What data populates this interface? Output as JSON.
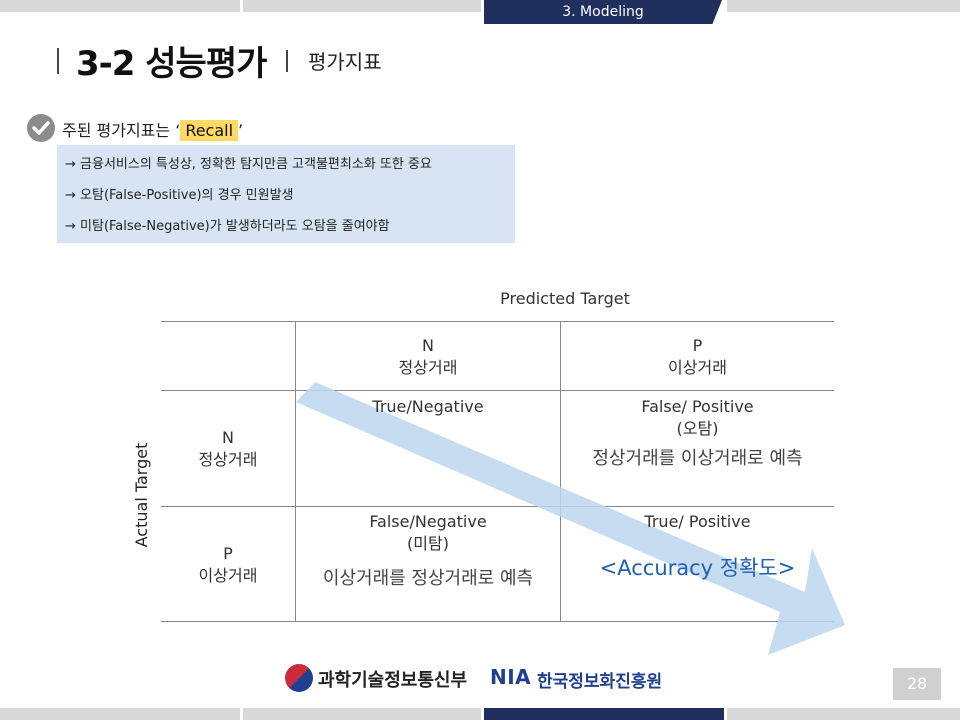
{
  "header": {
    "section_label": "3. Modeling"
  },
  "title": {
    "main": "3-2 성능평가",
    "sub": "평가지표"
  },
  "bullet": {
    "prefix": "주된 평가지표는 ‘",
    "highlight": "Recall",
    "suffix": "’"
  },
  "notes": [
    "→ 금융서비스의 특성상, 정확한 탐지만큼 고객불편최소화 또한 중요",
    "→ 오탐(False-Positive)의 경우 민원발생",
    "→ 미탐(False-Negative)가 발생하더라도 오탐을 줄여야함"
  ],
  "matrix": {
    "predicted_label": "Predicted Target",
    "actual_label": "Actual Target",
    "col_n": {
      "code": "N",
      "name": "정상거래"
    },
    "col_p": {
      "code": "P",
      "name": "이상거래"
    },
    "row_n": {
      "code": "N",
      "name": "정상거래"
    },
    "row_p": {
      "code": "P",
      "name": "이상거래"
    },
    "tn": {
      "label": "True/Negative"
    },
    "fp": {
      "label": "False/ Positive",
      "sub": "(오탐)",
      "desc": "정상거래를 이상거래로 예측"
    },
    "fn": {
      "label": "False/Negative",
      "sub": "(미탐)",
      "desc": "이상거래를 정상거래로 예측"
    },
    "tp": {
      "label": "True/ Positive",
      "desc": "<Accuracy 정확도>"
    }
  },
  "footer": {
    "org1": "과학기술정보통신부",
    "org2_abbr": "NIA",
    "org2_name": "한국정보화진흥원",
    "page_number": "28"
  },
  "colors": {
    "navy": "#1f2f5e",
    "arrow": "#bcd6ee",
    "accuracy": "#1f5fb4",
    "highlight": "#ffd966",
    "note_box": "#d6e4f3"
  }
}
